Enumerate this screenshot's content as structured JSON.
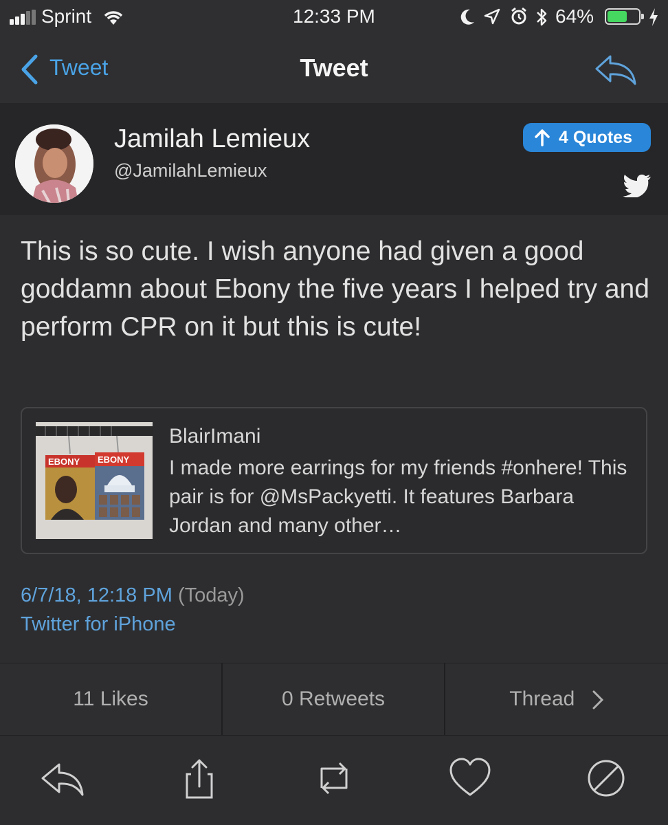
{
  "status_bar": {
    "carrier": "Sprint",
    "time": "12:33 PM",
    "battery_percent": "64%",
    "battery_level": 0.64
  },
  "nav": {
    "back_label": "Tweet",
    "title": "Tweet"
  },
  "author": {
    "name": "Jamilah Lemieux",
    "handle": "@JamilahLemieux",
    "quotes_badge": "4 Quotes"
  },
  "tweet": {
    "text": "This is so cute. I wish anyone had given a good goddamn about Ebony the five years I helped try and perform CPR on it but this is cute!"
  },
  "quoted": {
    "user": "BlairImani",
    "text": "I made more earrings for my friends #onhere! This pair is for @MsPackyetti. It features Barbara Jordan and many other…",
    "image_labels": [
      "EBONY",
      "EBONY"
    ]
  },
  "meta": {
    "date": "6/7/18, 12:18 PM",
    "relative": "(Today)",
    "source": "Twitter for iPhone"
  },
  "stats": {
    "likes": "11 Likes",
    "retweets": "0 Retweets",
    "thread": "Thread"
  },
  "colors": {
    "accent": "#4aa3e6",
    "badge": "#2a86d8",
    "battery": "#45d760"
  }
}
